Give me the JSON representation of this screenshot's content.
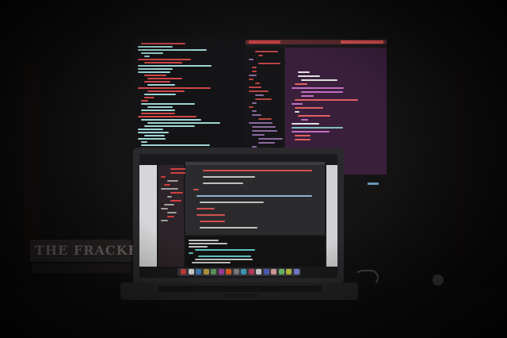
{
  "scene": {
    "description_tag": "dark-room-coding-setup",
    "book": {
      "spine_text": "THE FRACKER"
    }
  },
  "colors": {
    "background": "#0b0b0c",
    "monitor_code_red": "#d04848",
    "monitor_code_teal": "#9fd4d4",
    "editor_purple": "#3a1f3c",
    "laptop_body": "#2a2a2d",
    "screen_white": "#d6d6d8"
  },
  "icons": [
    "laptop-icon",
    "monitor-icon",
    "book-icon",
    "cable-icon"
  ]
}
